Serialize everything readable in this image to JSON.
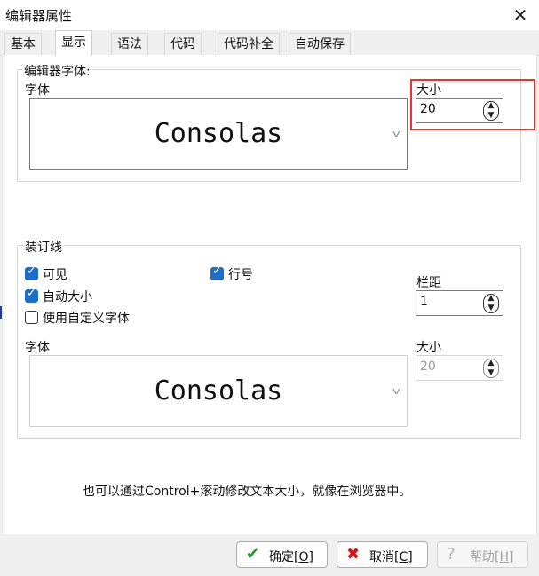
{
  "window": {
    "title": "编辑器属性",
    "close_icon": "✕"
  },
  "tabs": [
    {
      "label": "基本"
    },
    {
      "label": "显示",
      "active": true
    },
    {
      "label": "语法"
    },
    {
      "label": "代码"
    },
    {
      "label": "代码补全"
    },
    {
      "label": "自动保存"
    }
  ],
  "editor_font": {
    "group_title": "编辑器字体:",
    "font_label": "字体",
    "font_value": "Consolas",
    "size_label": "大小",
    "size_value": "20"
  },
  "gutter": {
    "group_title": "装订线",
    "visible": {
      "label": "可见",
      "checked": true
    },
    "line_numbers": {
      "label": "行号",
      "checked": true
    },
    "auto_size": {
      "label": "自动大小",
      "checked": true
    },
    "custom_font": {
      "label": "使用自定义字体",
      "checked": false
    },
    "margin_label": "栏距",
    "margin_value": "1",
    "font_label": "字体",
    "font_value": "Consolas",
    "size_label": "大小",
    "size_value": "20"
  },
  "hint_text": "也可以通过Control+滚动修改文本大小，就像在浏览器中。",
  "footer": {
    "ok": {
      "label": "确定",
      "key": "[O]",
      "icon": "✔"
    },
    "cancel": {
      "label": "取消",
      "key": "[C]",
      "icon": "✖"
    },
    "help": {
      "label": "帮助",
      "key": "[H]",
      "icon": "?"
    }
  },
  "colors": {
    "accent_checkbox": "#1f6fc9",
    "highlight_box": "#e23a2a",
    "ok_icon": "#1a9a2a",
    "cancel_icon": "#d01818"
  }
}
